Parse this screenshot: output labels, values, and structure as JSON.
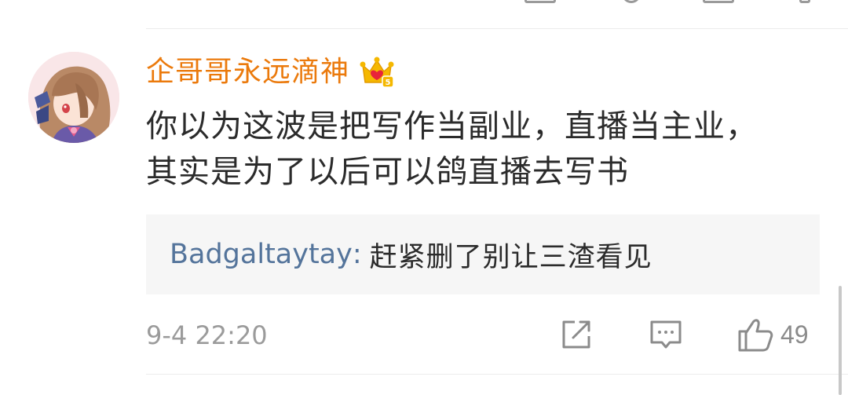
{
  "comment": {
    "username": "企哥哥永远滴神",
    "badge_icon": "crown-badge-icon",
    "text": "你以为这波是把写作当副业，直播当主业，\n其实是为了以后可以鸽直播去写书",
    "timestamp": "9-4 22:20",
    "like_count": "49"
  },
  "reply": {
    "user": "Badgaltaytay",
    "colon": ":",
    "text": "赶紧删了别让三渣看见"
  },
  "icons": {
    "share": "share-icon",
    "comment": "comment-icon",
    "like": "thumbs-up-icon"
  },
  "colors": {
    "username": "#eb7a0c",
    "reply_user": "#54749b",
    "body_text": "#2b2b2b",
    "meta_text": "#9b9b9b",
    "reply_background": "#f6f6f6"
  }
}
